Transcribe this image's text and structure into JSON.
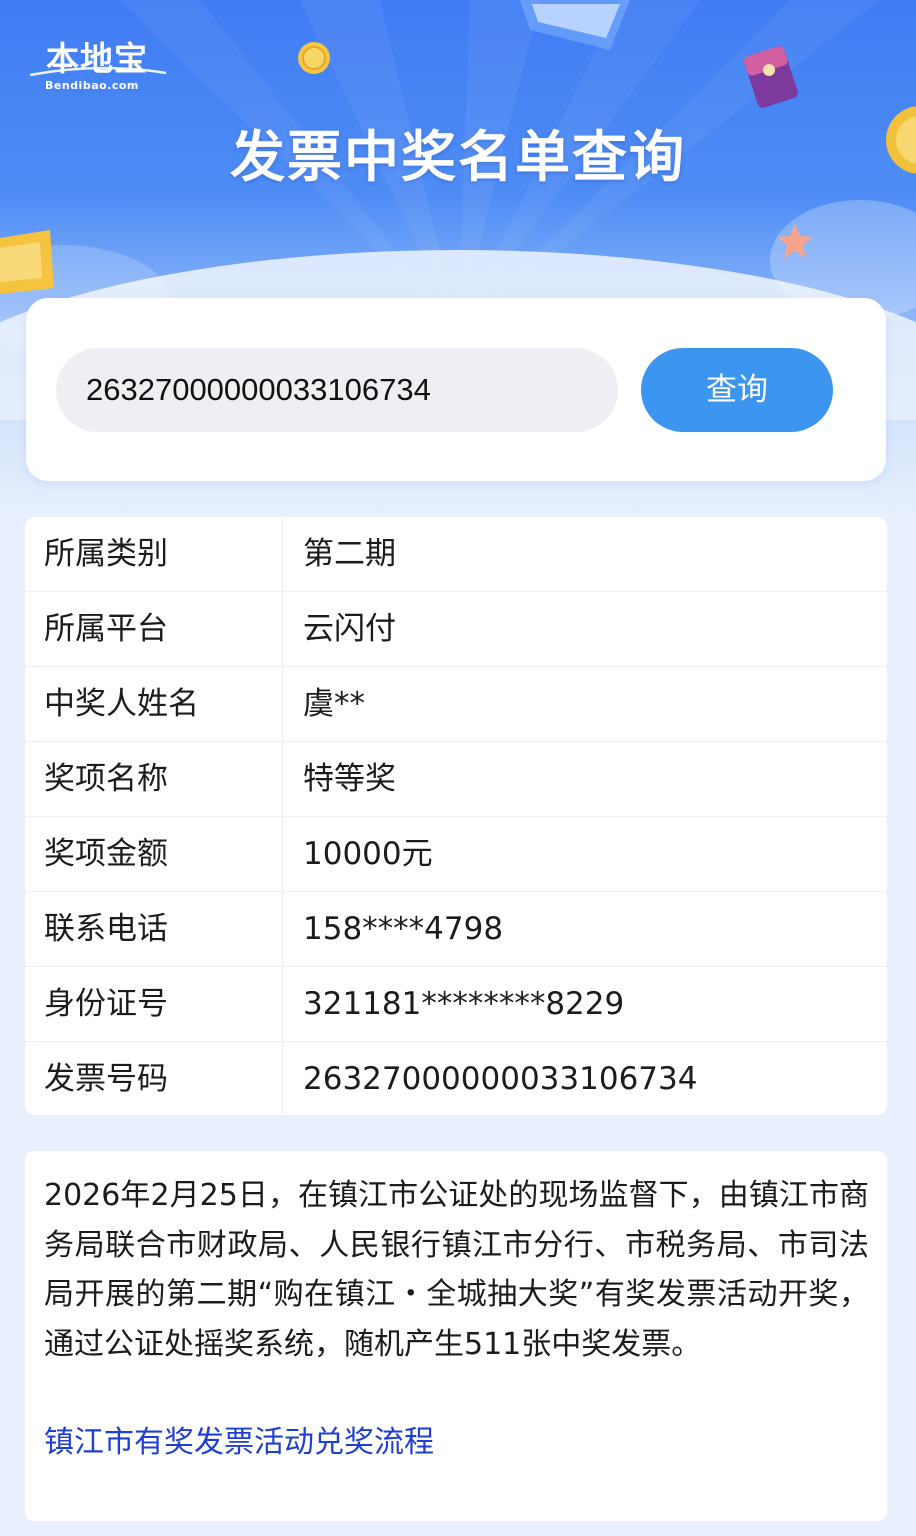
{
  "brand": {
    "name": "本地宝",
    "domain": "Bendibao.com"
  },
  "page": {
    "title": "发票中奖名单查询"
  },
  "search": {
    "value": "26327000000033106734",
    "button_label": "查询"
  },
  "result": {
    "rows": [
      {
        "label": "所属类别",
        "value": "第二期"
      },
      {
        "label": "所属平台",
        "value": "云闪付"
      },
      {
        "label": "中奖人姓名",
        "value": "虞**"
      },
      {
        "label": "奖项名称",
        "value": "特等奖"
      },
      {
        "label": "奖项金额",
        "value": "10000元"
      },
      {
        "label": "联系电话",
        "value": "158****4798"
      },
      {
        "label": "身份证号",
        "value": "321181********8229"
      },
      {
        "label": "发票号码",
        "value": "26327000000033106734"
      }
    ]
  },
  "notice": {
    "text": "2026年2月25日，在镇江市公证处的现场监督下，由镇江市商务局联合市财政局、人民银行镇江市分行、市税务局、市司法局开展的第二期“购在镇江・全城抽大奖”有奖发票活动开奖，通过公证处摇奖系统，随机产生511张中奖发票。",
    "link_label": "镇江市有奖发票活动兑奖流程"
  },
  "colors": {
    "banner_top": "#3f7cf4",
    "accent_button": "#3c96ef",
    "link": "#1f3fd0",
    "page_background": "#e8f0fd"
  }
}
